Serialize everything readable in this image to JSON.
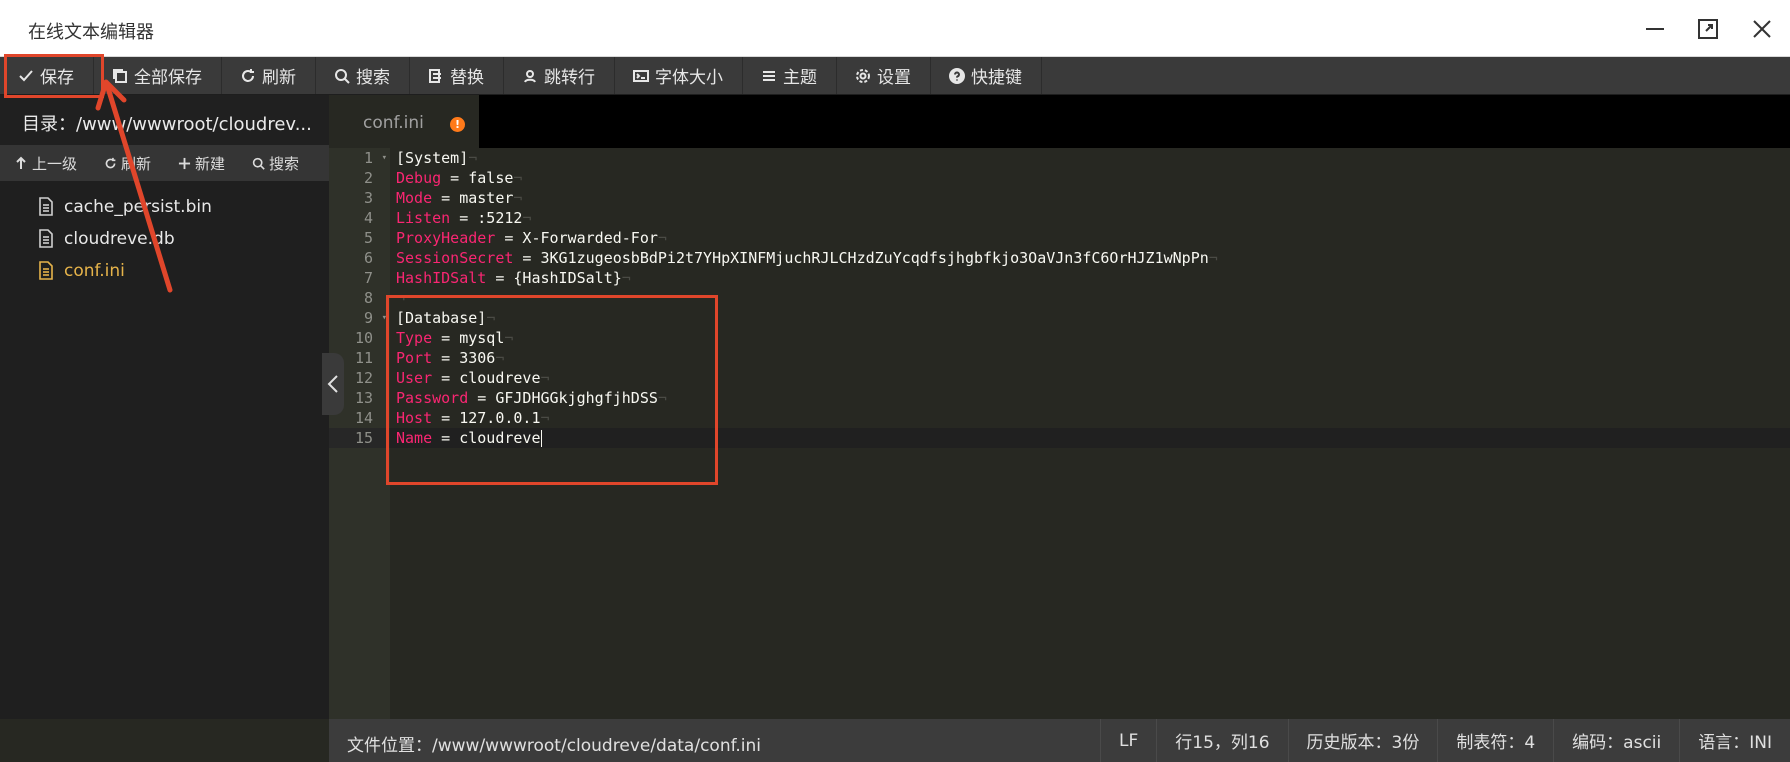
{
  "window": {
    "title": "在线文本编辑器"
  },
  "toolbar": {
    "items": [
      {
        "label": "保存",
        "icon": "check-icon"
      },
      {
        "label": "全部保存",
        "icon": "copy-icon"
      },
      {
        "label": "刷新",
        "icon": "refresh-icon"
      },
      {
        "label": "搜索",
        "icon": "search-icon"
      },
      {
        "label": "替换",
        "icon": "replace-icon"
      },
      {
        "label": "跳转行",
        "icon": "jump-icon"
      },
      {
        "label": "字体大小",
        "icon": "font-size-icon"
      },
      {
        "label": "主题",
        "icon": "menu-icon"
      },
      {
        "label": "设置",
        "icon": "gear-icon"
      },
      {
        "label": "快捷键",
        "icon": "help-icon"
      }
    ]
  },
  "sidebar": {
    "directory": "目录：/www/wwwroot/cloudrev...",
    "actions": [
      {
        "label": "上一级",
        "icon": "arrow-up-icon"
      },
      {
        "label": "刷新",
        "icon": "refresh-icon"
      },
      {
        "label": "新建",
        "icon": "plus-icon"
      },
      {
        "label": "搜索",
        "icon": "search-icon"
      }
    ],
    "files": [
      {
        "name": "cache_persist.bin",
        "active": false
      },
      {
        "name": "cloudreve.db",
        "active": false
      },
      {
        "name": "conf.ini",
        "active": true
      }
    ]
  },
  "editor": {
    "tab": {
      "name": "conf.ini",
      "modified_badge": "!"
    },
    "lines": [
      {
        "n": "1",
        "key": "",
        "text": "[System]",
        "fold": true
      },
      {
        "n": "2",
        "key": "Debug",
        "text": " = false",
        "fold": false
      },
      {
        "n": "3",
        "key": "Mode",
        "text": " = master",
        "fold": false
      },
      {
        "n": "4",
        "key": "Listen",
        "text": " = :5212",
        "fold": false
      },
      {
        "n": "5",
        "key": "ProxyHeader",
        "text": " = X-Forwarded-For",
        "fold": false
      },
      {
        "n": "6",
        "key": "SessionSecret",
        "text": " = 3KG1zugeosbBdPi2t7YHpXINFMjuchRJLCHzdZuYcqdfsjhgbfkjo3OaVJn3fC6OrHJZ1wNpPn",
        "fold": false
      },
      {
        "n": "7",
        "key": "HashIDSalt",
        "text": " = {HashIDSalt}",
        "fold": false
      },
      {
        "n": "8",
        "key": "",
        "text": "",
        "fold": false
      },
      {
        "n": "9",
        "key": "",
        "text": "[Database]",
        "fold": true
      },
      {
        "n": "10",
        "key": "Type",
        "text": " = mysql",
        "fold": false
      },
      {
        "n": "11",
        "key": "Port",
        "text": " = 3306",
        "fold": false
      },
      {
        "n": "12",
        "key": "User",
        "text": " = cloudreve",
        "fold": false
      },
      {
        "n": "13",
        "key": "Password",
        "text": " = GFJDHGGkjghgfjhDSS",
        "fold": false
      },
      {
        "n": "14",
        "key": "Host",
        "text": " = 127.0.0.1",
        "fold": false
      },
      {
        "n": "15",
        "key": "Name",
        "text": " = cloudreve",
        "fold": false
      }
    ],
    "active_line": 15
  },
  "statusbar": {
    "path": "文件位置：/www/wwwroot/cloudreve/data/conf.ini",
    "line_ending": "LF",
    "cursor": "行15，列16",
    "history": "历史版本：3份",
    "tab_size": "制表符：4",
    "encoding": "编码：ascii",
    "language": "语言：INI"
  },
  "colors": {
    "accent_annotation": "#e0462b",
    "key": "#f92672",
    "active_file": "#e6b34a",
    "modified_badge": "#ff7a1a"
  }
}
